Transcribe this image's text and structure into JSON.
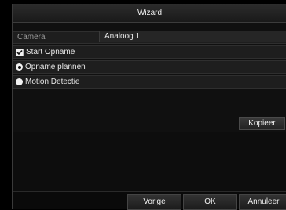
{
  "window": {
    "title": "Wizard"
  },
  "camera": {
    "label": "Camera",
    "value": "Analoog 1"
  },
  "options": {
    "start_opname": {
      "label": "Start Opname",
      "checked": true
    },
    "opname_plannen": {
      "label": "Opname plannen",
      "selected": true
    },
    "motion_detectie": {
      "label": "Motion Detectie",
      "selected": false
    }
  },
  "buttons": {
    "kopieer": "Kopieer",
    "vorige": "Vorige",
    "ok": "OK",
    "annuleer": "Annuleer"
  }
}
